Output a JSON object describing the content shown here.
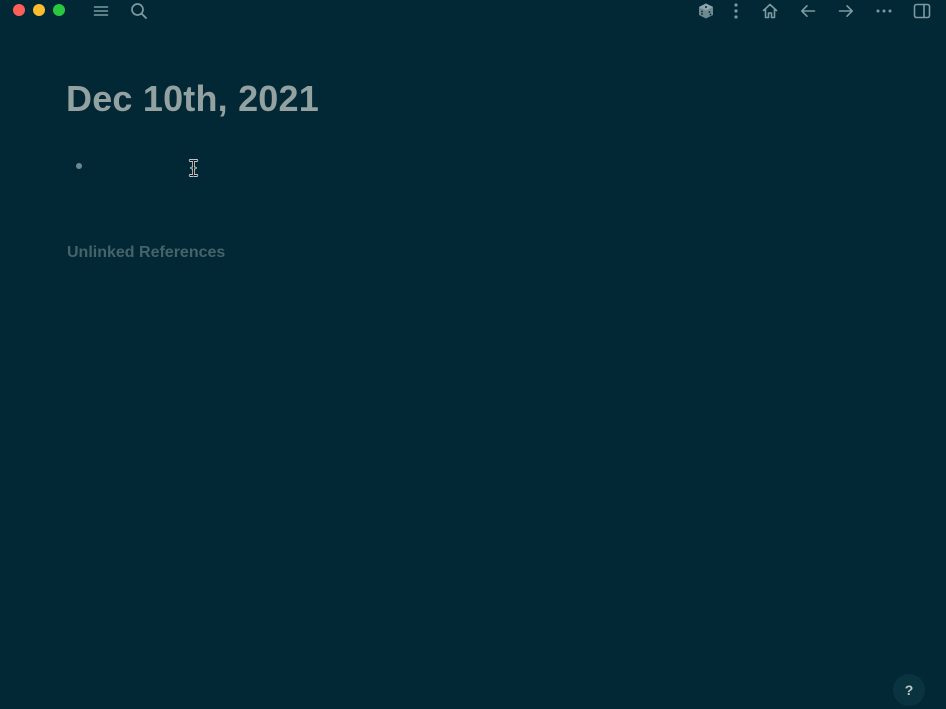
{
  "window": {
    "controls": [
      "close",
      "minimize",
      "zoom"
    ]
  },
  "toolbar": {
    "left_icons": [
      "menu-icon",
      "search-icon"
    ],
    "right_icons": [
      "dice-icon",
      "kebab-menu-icon",
      "home-icon",
      "arrow-left-icon",
      "arrow-right-icon",
      "more-horizontal-icon",
      "sidebar-icon"
    ]
  },
  "page": {
    "title": "Dec 10th, 2021",
    "blocks": [
      ""
    ],
    "unlinked_references_label": "Unlinked References"
  },
  "help": {
    "label": "?"
  },
  "colors": {
    "background": "#012834",
    "title": "#93a1a1",
    "muted": "#46636a",
    "icon": "#7e9aa0"
  }
}
